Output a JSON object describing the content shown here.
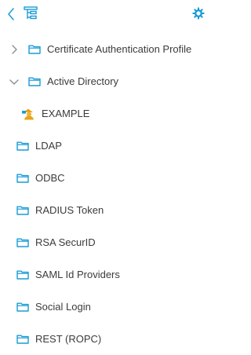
{
  "toolbar": {
    "back_icon": "chevron-left-icon",
    "tree_icon": "tree-structure-icon",
    "settings_icon": "gear-icon"
  },
  "colors": {
    "accent": "#1a9bd7",
    "text": "#3b3b3b",
    "chevron": "#8a8a8a",
    "domain_icon": "#e8a317"
  },
  "tree": {
    "items": [
      {
        "label": "Certificate Authentication Profile",
        "icon": "folder-icon",
        "toggle": "chevron-right-icon"
      },
      {
        "label": "Active Directory",
        "icon": "folder-icon",
        "toggle": "chevron-down-icon"
      },
      {
        "label": "EXAMPLE",
        "icon": "domain-join-icon"
      },
      {
        "label": "LDAP",
        "icon": "folder-icon"
      },
      {
        "label": "ODBC",
        "icon": "folder-icon"
      },
      {
        "label": "RADIUS Token",
        "icon": "folder-icon"
      },
      {
        "label": "RSA SecurID",
        "icon": "folder-icon"
      },
      {
        "label": "SAML Id Providers",
        "icon": "folder-icon"
      },
      {
        "label": "Social Login",
        "icon": "folder-icon"
      },
      {
        "label": "REST (ROPC)",
        "icon": "folder-icon"
      }
    ]
  }
}
